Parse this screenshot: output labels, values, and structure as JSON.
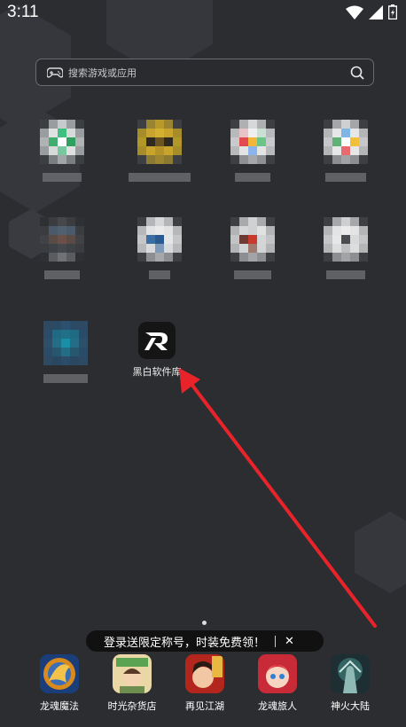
{
  "status": {
    "time": "3:11",
    "icons": [
      "wifi-icon",
      "signal-icon",
      "battery-icon"
    ]
  },
  "search": {
    "placeholder": "搜索游戏或应用"
  },
  "featured_app": {
    "label": "黑白软件库",
    "icon": "hb-logo-icon"
  },
  "promo": {
    "text": "登录送限定称号，时装免费领！",
    "close": "✕"
  },
  "dock": [
    {
      "label": "龙魂魔法"
    },
    {
      "label": "时光杂货店"
    },
    {
      "label": "再见江湖"
    },
    {
      "label": "龙魂旅人"
    },
    {
      "label": "神火大陆"
    }
  ],
  "colors": {
    "background": "#2c2d31",
    "arrow": "#e8232a"
  }
}
